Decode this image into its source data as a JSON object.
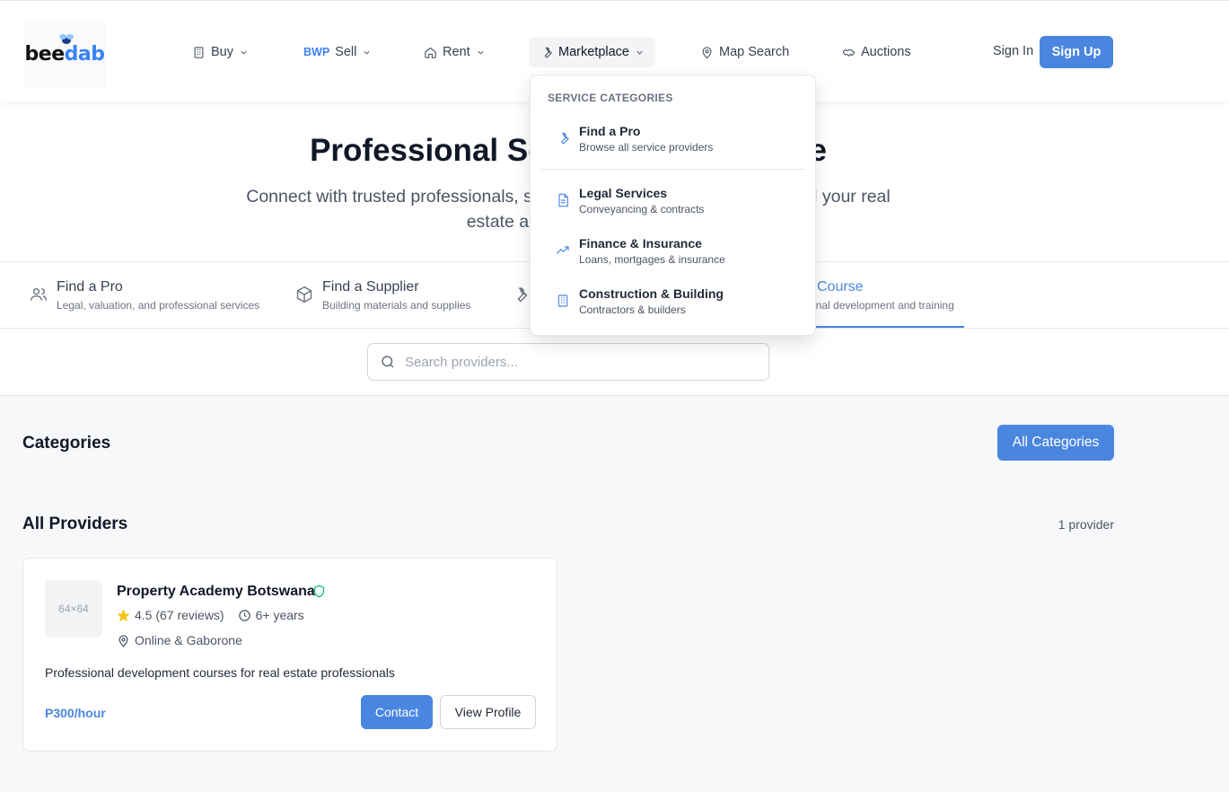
{
  "brand": {
    "logo_text_a": "bee",
    "logo_text_b": "dab"
  },
  "nav": {
    "buy": "Buy",
    "sell_prefix": "BWP",
    "sell": "Sell",
    "rent": "Rent",
    "marketplace": "Marketplace",
    "map_search": "Map Search",
    "auctions": "Auctions",
    "sign_in": "Sign In",
    "sign_up": "Sign Up"
  },
  "hero": {
    "title": "Professional Services Marketplace",
    "subtitle": "Connect with trusted professionals, suppliers, and service providers for all your real estate and property needs"
  },
  "tabs": [
    {
      "title": "Find a Pro",
      "desc": "Legal, valuation, and professional services"
    },
    {
      "title": "Find a Supplier",
      "desc": "Building materials and supplies"
    },
    {
      "title": "Course",
      "desc": "onal development and training"
    }
  ],
  "search": {
    "placeholder": "Search providers..."
  },
  "categories": {
    "title": "Categories",
    "all_button": "All Categories"
  },
  "providers": {
    "title": "All Providers",
    "count": "1 provider",
    "items": [
      {
        "thumb": "64×64",
        "name": "Property Academy Botswana",
        "rating": "4.5 (67 reviews)",
        "experience": "6+ years",
        "location": "Online & Gaborone",
        "description": "Professional development courses for real estate professionals",
        "price": "P300/hour",
        "contact": "Contact",
        "view_profile": "View Profile"
      }
    ]
  },
  "dropdown": {
    "heading": "SERVICE CATEGORIES",
    "items": [
      {
        "title": "Find a Pro",
        "desc": "Browse all service providers",
        "icon": "wrench-icon"
      },
      {
        "title": "Legal Services",
        "desc": "Conveyancing & contracts",
        "icon": "document-icon"
      },
      {
        "title": "Finance & Insurance",
        "desc": "Loans, mortgages & insurance",
        "icon": "trending-up-icon"
      },
      {
        "title": "Construction & Building",
        "desc": "Contractors & builders",
        "icon": "building-icon"
      }
    ]
  },
  "colors": {
    "accent": "#4a86e0",
    "verified": "#10b981",
    "star": "#f5c518"
  }
}
